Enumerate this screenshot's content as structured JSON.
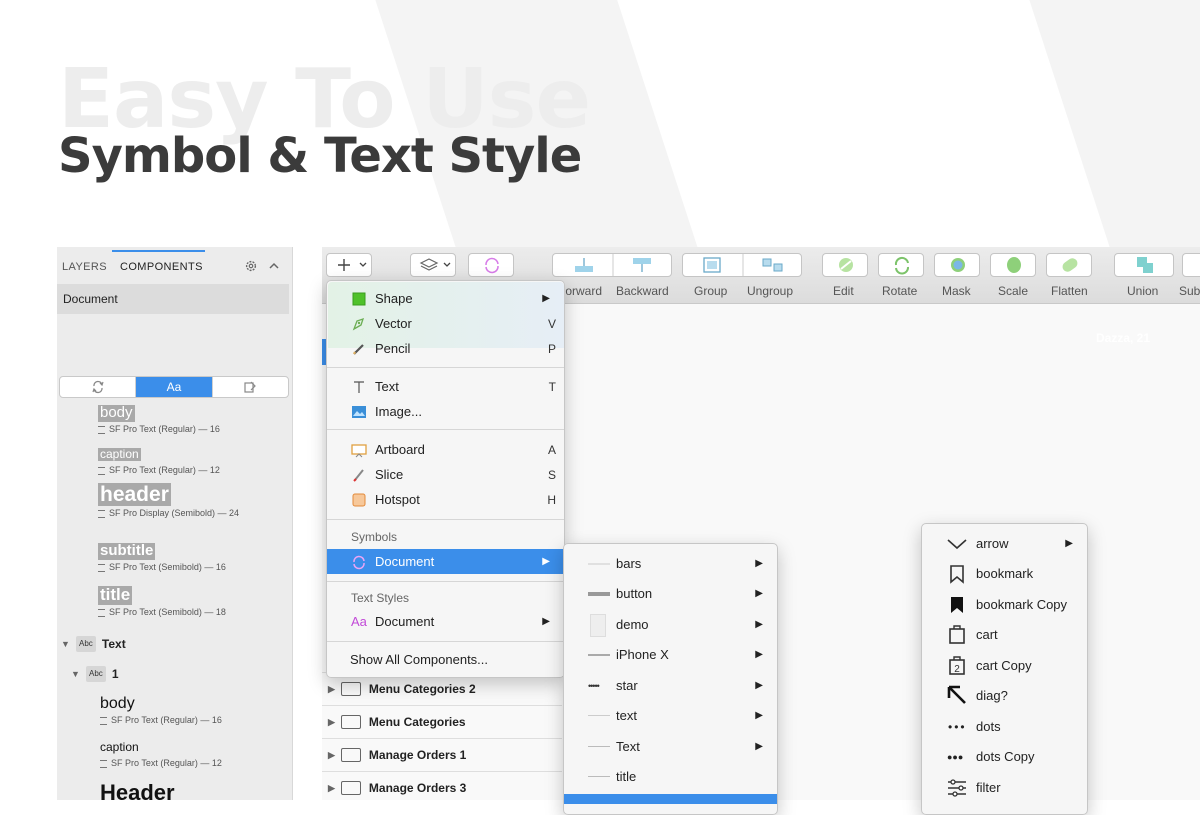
{
  "headline": {
    "watermark": "Easy To Use",
    "title": "Symbol & Text Style"
  },
  "left_panel": {
    "tabs": [
      "LAYERS",
      "COMPONENTS"
    ],
    "document": "Document",
    "segment_text_icon": "Aa",
    "text_styles": [
      {
        "name": "body",
        "meta": "SF Pro Text (Regular) — 16"
      },
      {
        "name": "caption",
        "meta": "SF Pro Text (Regular) — 12"
      },
      {
        "name": "header",
        "meta": "SF Pro Display (Semibold) — 24"
      },
      {
        "name": "subtitle",
        "meta": "SF Pro Text (Semibold) — 16"
      },
      {
        "name": "title",
        "meta": "SF Pro Text (Semibold) — 18"
      }
    ],
    "tree": {
      "group": "Text",
      "badge": "Abc",
      "subgroup": "1",
      "items": [
        {
          "name": "body",
          "meta": "SF Pro Text (Regular) — 16"
        },
        {
          "name": "caption",
          "meta": "SF Pro Text (Regular) — 12"
        },
        {
          "name": "Header"
        }
      ]
    }
  },
  "toolbar": {
    "items": [
      "Forward",
      "Backward",
      "Group",
      "Ungroup",
      "Edit",
      "Rotate",
      "Mask",
      "Scale",
      "Flatten",
      "Union",
      "Sub"
    ]
  },
  "canvas": {
    "artboard_label": "Dazza, 21"
  },
  "layers": [
    "Menu Categories 2",
    "Menu Categories",
    "Manage Orders 1",
    "Manage Orders 3"
  ],
  "insert_menu": {
    "items": [
      {
        "label": "Shape",
        "key": "",
        "submenu": true,
        "icon": "shape-icon"
      },
      {
        "label": "Vector",
        "key": "V",
        "icon": "vector-pen-icon"
      },
      {
        "label": "Pencil",
        "key": "P",
        "icon": "pencil-icon"
      },
      {
        "label": "Text",
        "key": "T",
        "icon": "text-cursor-icon"
      },
      {
        "label": "Image...",
        "key": "",
        "icon": "image-icon"
      },
      {
        "label": "Artboard",
        "key": "A",
        "icon": "artboard-icon"
      },
      {
        "label": "Slice",
        "key": "S",
        "icon": "slice-knife-icon"
      },
      {
        "label": "Hotspot",
        "key": "H",
        "icon": "hotspot-icon"
      }
    ],
    "symbols_header": "Symbols",
    "symbols_document": "Document",
    "text_styles_header": "Text Styles",
    "text_styles_icon": "Aa",
    "text_styles_document": "Document",
    "show_all": "Show All Components..."
  },
  "symbols_submenu": {
    "items": [
      {
        "label": "bars",
        "submenu": true
      },
      {
        "label": "button",
        "submenu": true
      },
      {
        "label": "demo",
        "submenu": true
      },
      {
        "label": "iPhone X",
        "submenu": true
      },
      {
        "label": "star",
        "submenu": true
      },
      {
        "label": "text",
        "submenu": true
      },
      {
        "label": "Text",
        "submenu": true
      },
      {
        "label": "title",
        "submenu": false
      }
    ],
    "star_glyph": "•••••"
  },
  "icon_submenu": {
    "items": [
      {
        "label": "arrow",
        "submenu": true,
        "icon": "chevron-down-icon"
      },
      {
        "label": "bookmark",
        "icon": "bookmark-outline-icon"
      },
      {
        "label": "bookmark Copy",
        "icon": "bookmark-filled-icon"
      },
      {
        "label": "cart",
        "icon": "cart-icon"
      },
      {
        "label": "cart Copy",
        "icon": "cart-copy-icon"
      },
      {
        "label": "diag?",
        "icon": "diagonal-arrow-icon"
      },
      {
        "label": "dots",
        "icon": "dots-icon"
      },
      {
        "label": "dots Copy",
        "icon": "dots-filled-icon"
      },
      {
        "label": "filter",
        "icon": "filter-icon"
      }
    ],
    "cart_copy_digit": "2",
    "dots_glyph": "•••",
    "dots_copy_glyph": "●●●"
  },
  "colors": {
    "accent": "#3b8eea",
    "headline": "#3b3b3b"
  }
}
